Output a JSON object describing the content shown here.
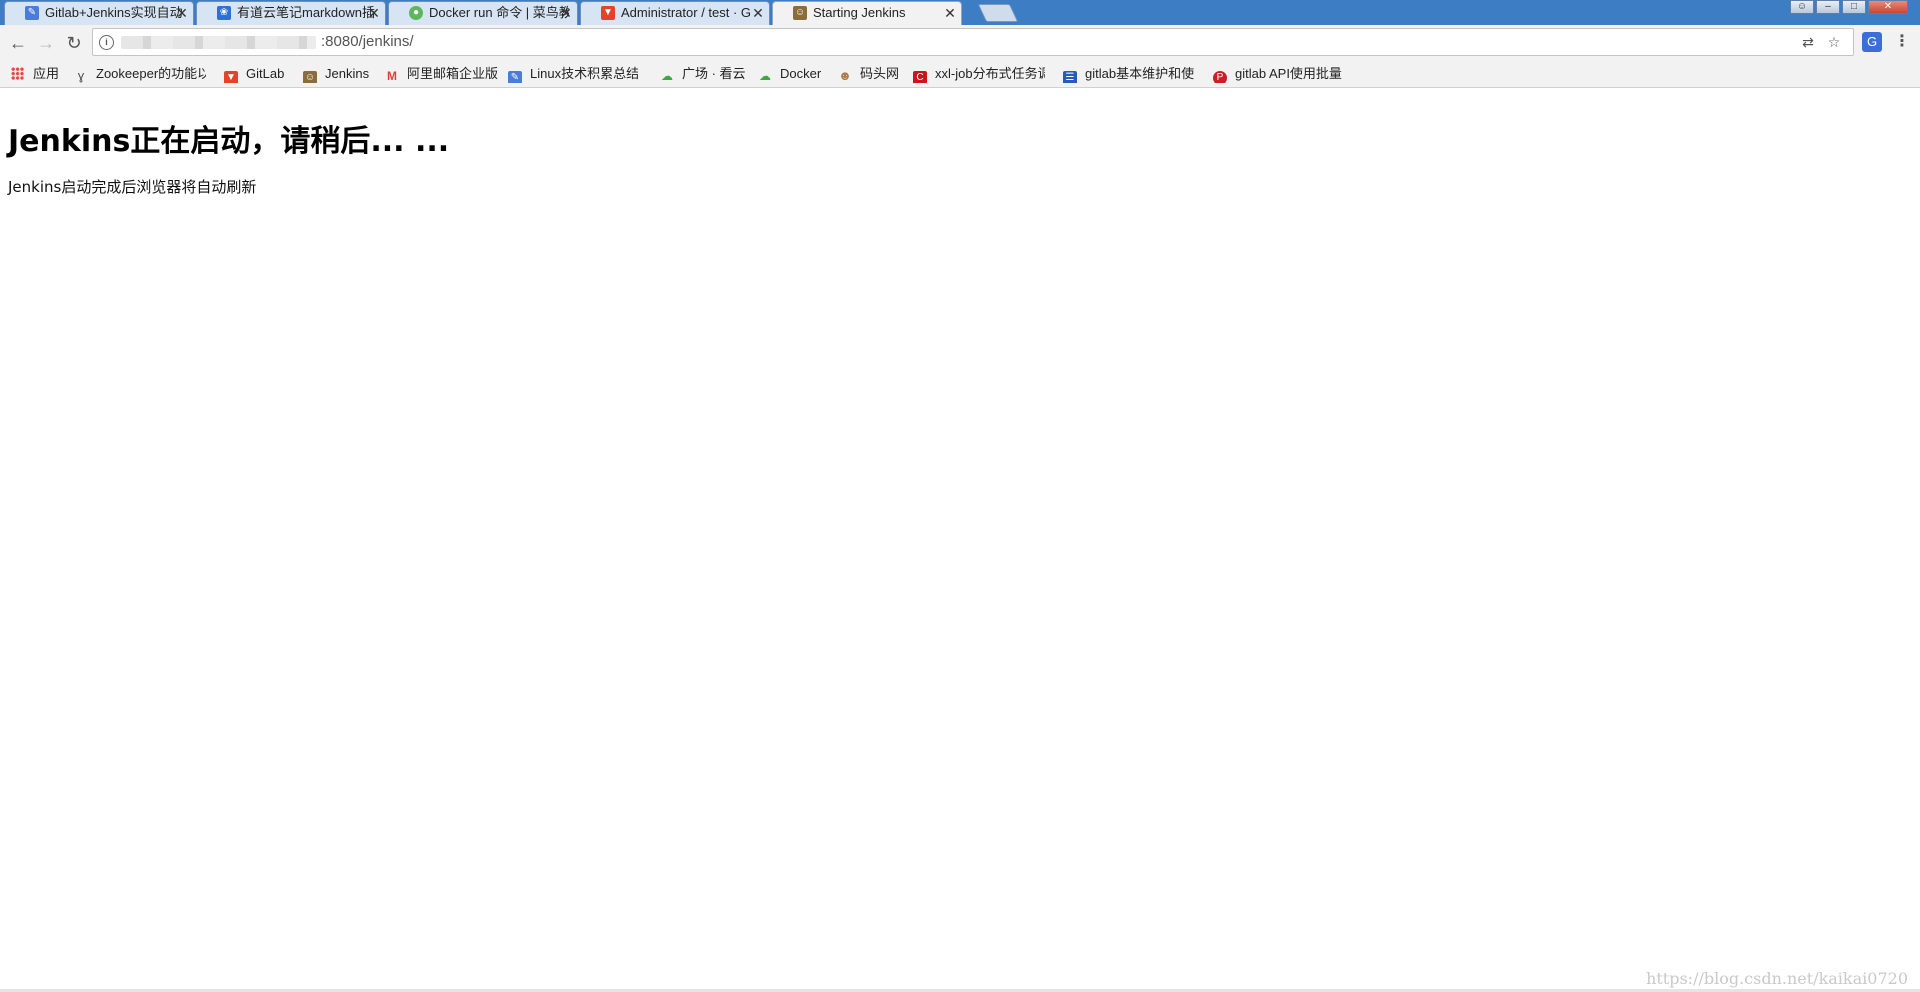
{
  "tabs": [
    {
      "title": "Gitlab+Jenkins实现自动",
      "icon": "pencil-icon",
      "color": "#4a7cdc"
    },
    {
      "title": "有道云笔记markdown插",
      "icon": "paw-icon",
      "color": "#2f6fd6"
    },
    {
      "title": "Docker run 命令 | 菜鸟教",
      "icon": "runoob-icon",
      "color": "#5cb85c"
    },
    {
      "title": "Administrator / test · G",
      "icon": "gitlab-icon",
      "color": "#e24329"
    },
    {
      "title": "Starting Jenkins",
      "icon": "jenkins-icon",
      "color": "#8a6d3b"
    }
  ],
  "tab_close_glyph": "✕",
  "address": {
    "url_suffix": ":8080/jenkins/"
  },
  "bookmarks": [
    {
      "label": "应用",
      "icon": "apps-icon"
    },
    {
      "label": "Zookeeper的功能以",
      "icon": "zookeeper-icon",
      "color": "#555555"
    },
    {
      "label": "GitLab",
      "icon": "gitlab-icon",
      "color": "#e24329"
    },
    {
      "label": "Jenkins",
      "icon": "jenkins-icon",
      "color": "#8a6d3b"
    },
    {
      "label": "阿里邮箱企业版",
      "icon": "mail-icon",
      "color": "#e0403a"
    },
    {
      "label": "Linux技术积累总结",
      "icon": "pencil-icon",
      "color": "#4a7cdc"
    },
    {
      "label": "广场 · 看云",
      "icon": "cloud-icon",
      "color": "#3aa843"
    },
    {
      "label": "Docker",
      "icon": "cloud-icon",
      "color": "#3aa843"
    },
    {
      "label": "码头网",
      "icon": "face-icon",
      "color": "#b07a4a"
    },
    {
      "label": "xxl-job分布式任务调",
      "icon": "c-icon",
      "color": "#d0121a"
    },
    {
      "label": "gitlab基本维护和使",
      "icon": "blog-icon",
      "color": "#2a5ab8"
    },
    {
      "label": "gitlab API使用批量",
      "icon": "pinterest-icon",
      "color": "#cb1f27"
    }
  ],
  "page": {
    "heading": "Jenkins正在启动，请稍后... ...",
    "message": "Jenkins启动完成后浏览器将自动刷新"
  },
  "watermark": "https://blog.csdn.net/kaikai0720"
}
